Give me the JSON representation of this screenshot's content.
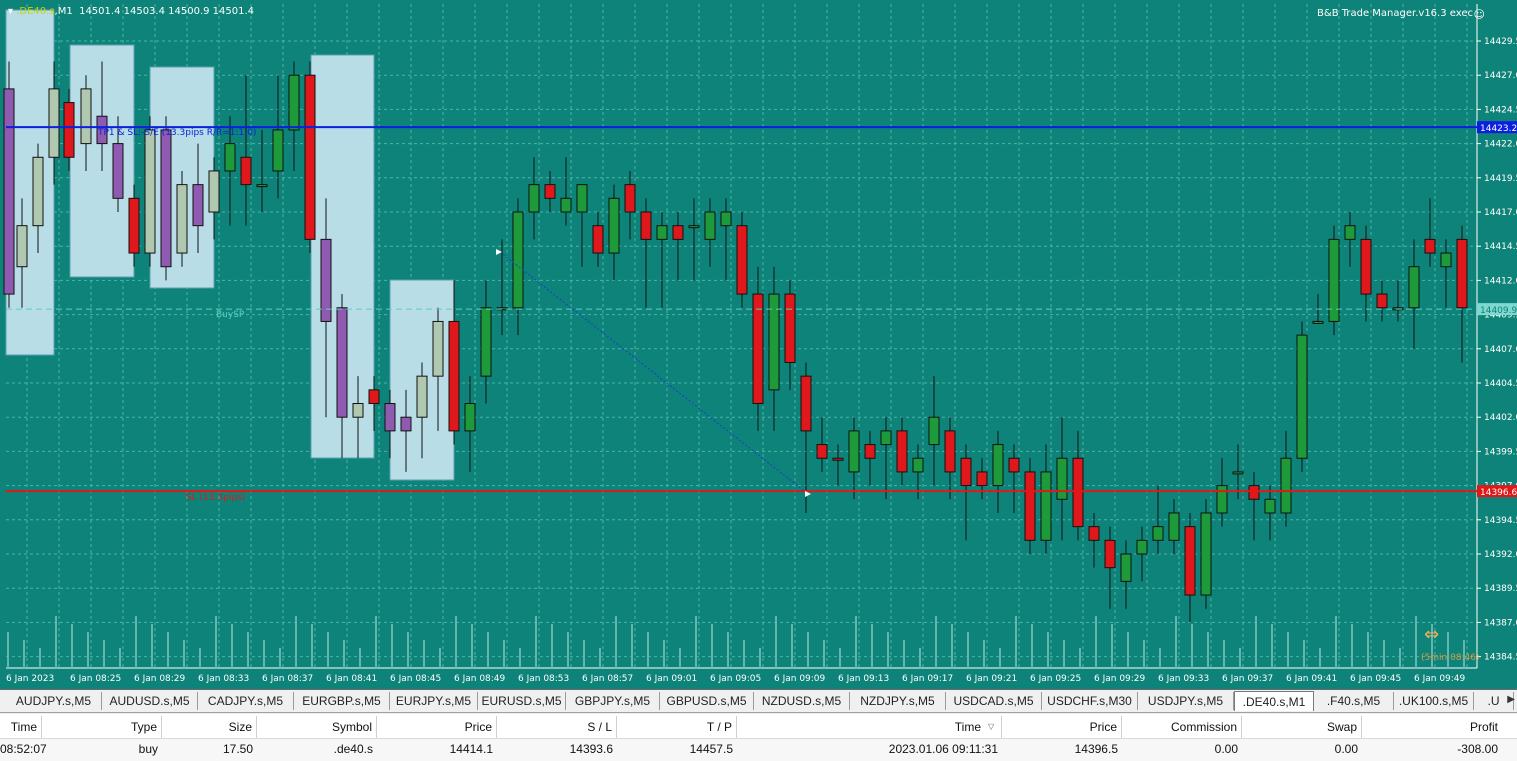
{
  "chart": {
    "symbol": ".DE40.s",
    "timeframe": "M1",
    "ohlc": "14501.4 14503.4 14500.9 14501.4",
    "ea_label": "B&B Trade Manager.v16.3 exec",
    "price_axis": [
      "14429.5",
      "14427.0",
      "14424.5",
      "14422.0",
      "14419.5",
      "14417.0",
      "14414.5",
      "14412.0",
      "14409.5",
      "14407.0",
      "14404.5",
      "14402.0",
      "14399.5",
      "14397.0",
      "14394.5",
      "14392.0",
      "14389.5",
      "14387.0",
      "14384.5"
    ],
    "time_axis": [
      "6 Jan 2023",
      "6 Jan 08:25",
      "6 Jan 08:29",
      "6 Jan 08:33",
      "6 Jan 08:37",
      "6 Jan 08:41",
      "6 Jan 08:45",
      "6 Jan 08:49",
      "6 Jan 08:53",
      "6 Jan 08:57",
      "6 Jan 09:01",
      "6 Jan 09:05",
      "6 Jan 09:09",
      "6 Jan 09:13",
      "6 Jan 09:17",
      "6 Jan 09:21",
      "6 Jan 09:25",
      "6 Jan 09:29",
      "6 Jan 09:33",
      "6 Jan 09:37",
      "6 Jan 09:41",
      "6 Jan 09:45",
      "6 Jan 09:49"
    ],
    "tp_line": {
      "price": 14423.2,
      "label": "TP1 & SL:-S/E (13.3pips R/R=1:1.0)",
      "tag": "14423.2"
    },
    "sl_line": {
      "price": 14396.6,
      "label": "SL (13.3pips)",
      "tag": "14396.6"
    },
    "entry_label": "BuySP",
    "entry_tag": "14409.9",
    "timer_label": "(5min 08:46)",
    "colors": {
      "bg": "#0e8379",
      "bull": "#1d9a3a",
      "bear": "#e0181b",
      "tp": "#0b1fe0",
      "sl": "#e01818"
    }
  },
  "symbol_tabs": [
    "AUDJPY.s,M5",
    "AUDUSD.s,M5",
    "CADJPY.s,M5",
    "EURGBP.s,M5",
    "EURJPY.s,M5",
    "EURUSD.s,M5",
    "GBPJPY.s,M5",
    "GBPUSD.s,M5",
    "NZDUSD.s,M5",
    "NZDJPY.s,M5",
    "USDCAD.s,M5",
    "USDCHF.s,M30",
    "USDJPY.s,M5",
    ".DE40.s,M1",
    ".F40.s,M5",
    ".UK100.s,M5",
    ".U"
  ],
  "active_tab": ".DE40.s,M1",
  "terminal": {
    "headers": {
      "time": "Time",
      "type": "Type",
      "size": "Size",
      "symbol": "Symbol",
      "price": "Price",
      "sl": "S / L",
      "tp": "T / P",
      "time2": "Time",
      "price2": "Price",
      "commission": "Commission",
      "swap": "Swap",
      "profit": "Profit"
    },
    "row": {
      "time": "08:52:07",
      "type": "buy",
      "size": "17.50",
      "symbol": ".de40.s",
      "price": "14414.1",
      "sl": "14393.6",
      "tp": "14457.5",
      "time2": "2023.01.06 09:11:31",
      "price2": "14396.5",
      "commission": "0.00",
      "swap": "0.00",
      "profit": "-308.00"
    }
  }
}
